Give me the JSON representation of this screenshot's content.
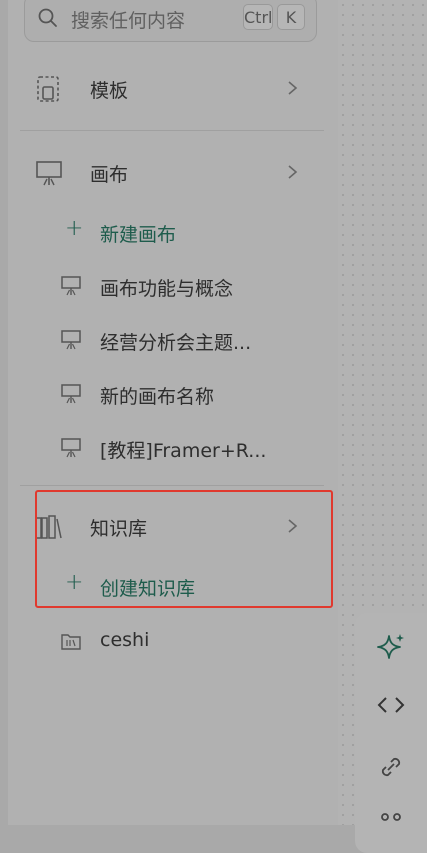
{
  "search": {
    "placeholder": "搜索任何内容",
    "shortcut_ctrl": "Ctrl",
    "shortcut_k": "K"
  },
  "templates": {
    "label": "模板"
  },
  "canvas": {
    "label": "画布",
    "new_label": "新建画布",
    "items": [
      "画布功能与概念",
      "经营分析会主题...",
      "新的画布名称",
      "[教程]Framer+R..."
    ]
  },
  "knowledge": {
    "label": "知识库",
    "create_label": "创建知识库",
    "items": [
      "ceshi"
    ]
  },
  "colors": {
    "accent": "#1e5c4c",
    "highlight": "#e0392e"
  }
}
